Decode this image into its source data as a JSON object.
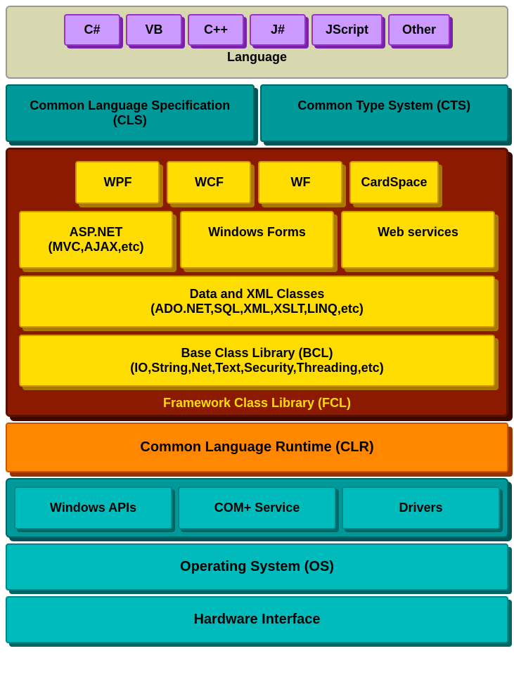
{
  "language": {
    "label": "Language",
    "items": [
      "C#",
      "VB",
      "C++",
      "J#",
      "JScript",
      "Other"
    ]
  },
  "cls": "Common Language Specification (CLS)",
  "cts": "Common Type System (CTS)",
  "fcl": {
    "label": "Framework Class Library (FCL)",
    "row1": [
      "WPF",
      "WCF",
      "WF",
      "CardSpace"
    ],
    "row2_left": "ASP.NET\n(MVC,AJAX,etc)",
    "row2_mid": "Windows Forms",
    "row2_right": "Web services",
    "row3_line1": "Data and XML Classes",
    "row3_line2": "(ADO.NET,SQL,XML,XSLT,LINQ,etc)",
    "row4_line1": "Base Class Library (BCL)",
    "row4_line2": "(IO,String,Net,Text,Security,Threading,etc)"
  },
  "clr": "Common Language Runtime (CLR)",
  "apis": {
    "windows": "Windows APIs",
    "com": "COM+ Service",
    "drivers": "Drivers"
  },
  "os": "Operating System (OS)",
  "hardware": "Hardware Interface"
}
